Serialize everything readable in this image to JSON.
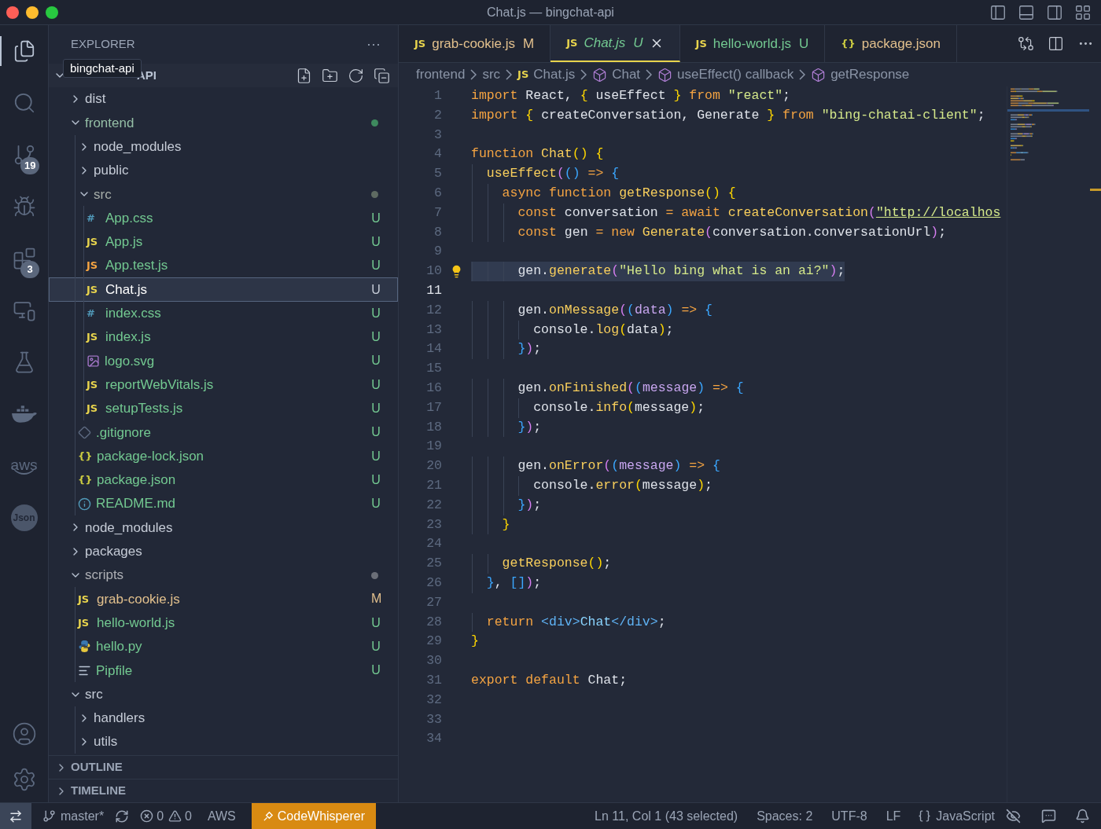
{
  "window": {
    "title": "Chat.js — bingchat-api"
  },
  "activity_bar": {
    "items": [
      {
        "kind": "files",
        "selected": true
      },
      {
        "kind": "search",
        "selected": false
      },
      {
        "kind": "source-control",
        "selected": false,
        "badge": "19"
      },
      {
        "kind": "run",
        "selected": false
      },
      {
        "kind": "extensions",
        "selected": false,
        "badge": "3"
      },
      {
        "kind": "remote",
        "selected": false
      },
      {
        "kind": "testing",
        "selected": false
      },
      {
        "kind": "docker",
        "selected": false
      },
      {
        "kind": "aws",
        "selected": false,
        "label": "aws"
      },
      {
        "kind": "json",
        "selected": false,
        "label": "Json"
      }
    ],
    "bottom": [
      {
        "kind": "account"
      },
      {
        "kind": "settings"
      }
    ]
  },
  "sidebar": {
    "title": "EXPLORER",
    "more": "···",
    "root": {
      "tooltip": "bingchat-api",
      "label_visible": "API",
      "expanded": true
    },
    "tree": [
      {
        "name": "dist",
        "kind": "folder",
        "expanded": false
      },
      {
        "name": "frontend",
        "kind": "folder",
        "expanded": true,
        "color": "#3e8a5e",
        "children": [
          {
            "name": "node_modules",
            "kind": "folder",
            "expanded": false
          },
          {
            "name": "public",
            "kind": "folder",
            "expanded": false
          },
          {
            "name": "src",
            "kind": "folder",
            "expanded": true,
            "color": "#5f6b62",
            "children": [
              {
                "name": "App.css",
                "kind": "css",
                "glyph": "#",
                "status": "U",
                "selected": false
              },
              {
                "name": "App.js",
                "kind": "js",
                "glyph": "JS",
                "status": "U",
                "selected": false
              },
              {
                "name": "App.test.js",
                "kind": "test",
                "glyph": "JS",
                "status": "U",
                "selected": false
              },
              {
                "name": "Chat.js",
                "kind": "js",
                "glyph": "JS",
                "status": "U",
                "selected": true
              },
              {
                "name": "index.css",
                "kind": "css",
                "glyph": "#",
                "status": "U",
                "selected": false
              },
              {
                "name": "index.js",
                "kind": "js",
                "glyph": "JS",
                "status": "U",
                "selected": false
              },
              {
                "name": "logo.svg",
                "kind": "image",
                "status": "U",
                "selected": false
              },
              {
                "name": "reportWebVitals.js",
                "kind": "js",
                "glyph": "JS",
                "status": "U",
                "selected": false
              },
              {
                "name": "setupTests.js",
                "kind": "js",
                "glyph": "JS",
                "status": "U",
                "selected": false
              }
            ]
          },
          {
            "name": ".gitignore",
            "kind": "git",
            "status": "U",
            "selected": false
          },
          {
            "name": "package-lock.json",
            "kind": "json",
            "glyph": "{}",
            "status": "U",
            "selected": false
          },
          {
            "name": "package.json",
            "kind": "json",
            "glyph": "{}",
            "status": "U",
            "selected": false
          },
          {
            "name": "README.md",
            "kind": "info",
            "status": "U",
            "selected": false
          }
        ]
      },
      {
        "name": "node_modules",
        "kind": "folder",
        "expanded": false
      },
      {
        "name": "packages",
        "kind": "folder",
        "expanded": false
      },
      {
        "name": "scripts",
        "kind": "folder",
        "expanded": true,
        "color": "#6b6f78",
        "children": [
          {
            "name": "grab-cookie.js",
            "kind": "js",
            "glyph": "JS",
            "status": "M",
            "selected": false
          },
          {
            "name": "hello-world.js",
            "kind": "js",
            "glyph": "JS",
            "status": "U",
            "selected": false
          },
          {
            "name": "hello.py",
            "kind": "python",
            "status": "U",
            "selected": false
          },
          {
            "name": "Pipfile",
            "kind": "lines",
            "status": "U",
            "selected": false
          }
        ]
      },
      {
        "name": "src",
        "kind": "folder",
        "expanded": true,
        "children": [
          {
            "name": "handlers",
            "kind": "folder",
            "expanded": false
          },
          {
            "name": "utils",
            "kind": "folder",
            "expanded": false
          }
        ]
      }
    ],
    "panels": [
      {
        "label": "OUTLINE",
        "expanded": false
      },
      {
        "label": "TIMELINE",
        "expanded": false
      }
    ]
  },
  "tabs": [
    {
      "glyph": "JS",
      "kind": "js",
      "label": "grab-cookie.js",
      "status": "M",
      "selected": false,
      "preview": false
    },
    {
      "glyph": "JS",
      "kind": "js",
      "label": "Chat.js",
      "status": "U",
      "selected": true,
      "preview": true
    },
    {
      "glyph": "JS",
      "kind": "js",
      "label": "hello-world.js",
      "status": "U",
      "selected": false,
      "preview": false
    },
    {
      "glyph": "{}",
      "kind": "json",
      "label": "package.json",
      "selected": false,
      "preview": false
    }
  ],
  "breadcrumbs": [
    {
      "kind": "folder",
      "label": "frontend"
    },
    {
      "kind": "folder",
      "label": "src"
    },
    {
      "kind": "file",
      "glyph": "JS",
      "label": "Chat.js"
    },
    {
      "kind": "symbol",
      "label": "Chat"
    },
    {
      "kind": "symbol",
      "label": "useEffect() callback"
    },
    {
      "kind": "symbol",
      "label": "getResponse"
    }
  ],
  "editor": {
    "lines": [
      {
        "n": "1",
        "current": false,
        "selected": false,
        "tokens": [
          {
            "kind": "keyword",
            "text": "import"
          },
          {
            "kind": "plain",
            "text": " React, "
          },
          {
            "kind": "brace",
            "text": "{"
          },
          {
            "kind": "plain",
            "text": " useEffect "
          },
          {
            "kind": "brace",
            "text": "}"
          },
          {
            "kind": "keyword",
            "text": " from "
          },
          {
            "kind": "string",
            "text": "\"react\""
          },
          {
            "kind": "plain",
            "text": ";"
          }
        ]
      },
      {
        "n": "2",
        "current": false,
        "selected": false,
        "tokens": [
          {
            "kind": "keyword",
            "text": "import"
          },
          {
            "kind": "brace",
            "text": " {"
          },
          {
            "kind": "plain",
            "text": " createConversation, Generate "
          },
          {
            "kind": "brace",
            "text": "}"
          },
          {
            "kind": "keyword",
            "text": " from "
          },
          {
            "kind": "string",
            "text": "\"bing-chatai-client\""
          },
          {
            "kind": "plain",
            "text": ";"
          }
        ]
      },
      {
        "n": "3",
        "current": false
      },
      {
        "n": "4",
        "current": false,
        "selected": false,
        "tokens": [
          {
            "kind": "keyword",
            "text": "function"
          },
          {
            "kind": "func",
            "text": " Chat"
          },
          {
            "kind": "brace",
            "text": "()"
          },
          {
            "kind": "brace",
            "text": " {"
          }
        ]
      },
      {
        "n": "5",
        "current": false,
        "selected": false,
        "tokens": [
          {
            "kind": "func",
            "text": "  useEffect"
          },
          {
            "kind": "paren",
            "text": "("
          },
          {
            "kind": "bracket",
            "text": "()"
          },
          {
            "kind": "keyword",
            "text": " => "
          },
          {
            "kind": "bracket",
            "text": "{"
          }
        ]
      },
      {
        "n": "6",
        "current": false,
        "selected": false,
        "tokens": [
          {
            "kind": "keyword",
            "text": "    async function"
          },
          {
            "kind": "func",
            "text": " getResponse"
          },
          {
            "kind": "brace",
            "text": "()"
          },
          {
            "kind": "brace",
            "text": " {"
          }
        ]
      },
      {
        "n": "7",
        "current": false,
        "selected": false,
        "tokens": [
          {
            "kind": "keyword",
            "text": "      const"
          },
          {
            "kind": "plain",
            "text": " conversation "
          },
          {
            "kind": "keyword",
            "text": "= await"
          },
          {
            "kind": "func",
            "text": " createConversation"
          },
          {
            "kind": "paren",
            "text": "("
          },
          {
            "kind": "link",
            "text": "\"http://localhos"
          }
        ]
      },
      {
        "n": "8",
        "current": false,
        "selected": false,
        "tokens": [
          {
            "kind": "keyword",
            "text": "      const"
          },
          {
            "kind": "plain",
            "text": " gen "
          },
          {
            "kind": "keyword",
            "text": "= new"
          },
          {
            "kind": "func",
            "text": " Generate"
          },
          {
            "kind": "paren",
            "text": "("
          },
          {
            "kind": "plain",
            "text": "conversation.conversationUrl"
          },
          {
            "kind": "paren",
            "text": ")"
          },
          {
            "kind": "plain",
            "text": ";"
          }
        ]
      },
      {
        "n": "9",
        "current": false
      },
      {
        "n": "10",
        "current": false,
        "selected": true,
        "kind": "lightbulb",
        "tokens": [
          {
            "kind": "plain",
            "text": "      gen."
          },
          {
            "kind": "func",
            "text": "generate"
          },
          {
            "kind": "paren",
            "text": "("
          },
          {
            "kind": "string",
            "text": "\"Hello bing what is an ai?\""
          },
          {
            "kind": "paren",
            "text": ")"
          },
          {
            "kind": "plain",
            "text": ";"
          }
        ]
      },
      {
        "n": "11",
        "current": true
      },
      {
        "n": "12",
        "current": false,
        "selected": false,
        "tokens": [
          {
            "kind": "plain",
            "text": "      gen."
          },
          {
            "kind": "func",
            "text": "onMessage"
          },
          {
            "kind": "paren",
            "text": "("
          },
          {
            "kind": "bracket",
            "text": "("
          },
          {
            "kind": "param",
            "text": "data"
          },
          {
            "kind": "bracket",
            "text": ")"
          },
          {
            "kind": "keyword",
            "text": " => "
          },
          {
            "kind": "bracket",
            "text": "{"
          }
        ]
      },
      {
        "n": "13",
        "current": false,
        "selected": false,
        "tokens": [
          {
            "kind": "plain",
            "text": "        console."
          },
          {
            "kind": "func",
            "text": "log"
          },
          {
            "kind": "brace",
            "text": "("
          },
          {
            "kind": "plain",
            "text": "data"
          },
          {
            "kind": "brace",
            "text": ")"
          },
          {
            "kind": "plain",
            "text": ";"
          }
        ]
      },
      {
        "n": "14",
        "current": false,
        "selected": false,
        "tokens": [
          {
            "kind": "bracket",
            "text": "      }"
          },
          {
            "kind": "paren",
            "text": ")"
          },
          {
            "kind": "plain",
            "text": ";"
          }
        ]
      },
      {
        "n": "15",
        "current": false
      },
      {
        "n": "16",
        "current": false,
        "selected": false,
        "tokens": [
          {
            "kind": "plain",
            "text": "      gen."
          },
          {
            "kind": "func",
            "text": "onFinished"
          },
          {
            "kind": "paren",
            "text": "("
          },
          {
            "kind": "bracket",
            "text": "("
          },
          {
            "kind": "param",
            "text": "message"
          },
          {
            "kind": "bracket",
            "text": ")"
          },
          {
            "kind": "keyword",
            "text": " => "
          },
          {
            "kind": "bracket",
            "text": "{"
          }
        ]
      },
      {
        "n": "17",
        "current": false,
        "selected": false,
        "tokens": [
          {
            "kind": "plain",
            "text": "        console."
          },
          {
            "kind": "func",
            "text": "info"
          },
          {
            "kind": "brace",
            "text": "("
          },
          {
            "kind": "plain",
            "text": "message"
          },
          {
            "kind": "brace",
            "text": ")"
          },
          {
            "kind": "plain",
            "text": ";"
          }
        ]
      },
      {
        "n": "18",
        "current": false,
        "selected": false,
        "tokens": [
          {
            "kind": "bracket",
            "text": "      }"
          },
          {
            "kind": "paren",
            "text": ")"
          },
          {
            "kind": "plain",
            "text": ";"
          }
        ]
      },
      {
        "n": "19",
        "current": false
      },
      {
        "n": "20",
        "current": false,
        "selected": false,
        "tokens": [
          {
            "kind": "plain",
            "text": "      gen."
          },
          {
            "kind": "func",
            "text": "onError"
          },
          {
            "kind": "paren",
            "text": "("
          },
          {
            "kind": "bracket",
            "text": "("
          },
          {
            "kind": "param",
            "text": "message"
          },
          {
            "kind": "bracket",
            "text": ")"
          },
          {
            "kind": "keyword",
            "text": " => "
          },
          {
            "kind": "bracket",
            "text": "{"
          }
        ]
      },
      {
        "n": "21",
        "current": false,
        "selected": false,
        "tokens": [
          {
            "kind": "plain",
            "text": "        console."
          },
          {
            "kind": "func",
            "text": "error"
          },
          {
            "kind": "brace",
            "text": "("
          },
          {
            "kind": "plain",
            "text": "message"
          },
          {
            "kind": "brace",
            "text": ")"
          },
          {
            "kind": "plain",
            "text": ";"
          }
        ]
      },
      {
        "n": "22",
        "current": false,
        "selected": false,
        "tokens": [
          {
            "kind": "bracket",
            "text": "      }"
          },
          {
            "kind": "paren",
            "text": ")"
          },
          {
            "kind": "plain",
            "text": ";"
          }
        ]
      },
      {
        "n": "23",
        "current": false,
        "selected": false,
        "tokens": [
          {
            "kind": "brace",
            "text": "    }"
          }
        ]
      },
      {
        "n": "24",
        "current": false
      },
      {
        "n": "25",
        "current": false,
        "selected": false,
        "tokens": [
          {
            "kind": "func",
            "text": "    getResponse"
          },
          {
            "kind": "brace",
            "text": "()"
          },
          {
            "kind": "plain",
            "text": ";"
          }
        ]
      },
      {
        "n": "26",
        "current": false,
        "selected": false,
        "tokens": [
          {
            "kind": "bracket",
            "text": "  }"
          },
          {
            "kind": "plain",
            "text": ", "
          },
          {
            "kind": "bracket",
            "text": "[]"
          },
          {
            "kind": "paren",
            "text": ")"
          },
          {
            "kind": "plain",
            "text": ";"
          }
        ]
      },
      {
        "n": "27",
        "current": false
      },
      {
        "n": "28",
        "current": false,
        "selected": false,
        "tokens": [
          {
            "kind": "keyword",
            "text": "  return"
          },
          {
            "kind": "tag",
            "text": " <div>"
          },
          {
            "kind": "jsx",
            "text": "Chat"
          },
          {
            "kind": "tag",
            "text": "</div>"
          },
          {
            "kind": "plain",
            "text": ";"
          }
        ]
      },
      {
        "n": "29",
        "current": false,
        "selected": false,
        "tokens": [
          {
            "kind": "brace",
            "text": "}"
          }
        ]
      },
      {
        "n": "30",
        "current": false
      },
      {
        "n": "31",
        "current": false,
        "selected": false,
        "tokens": [
          {
            "kind": "keyword",
            "text": "export default"
          },
          {
            "kind": "plain",
            "text": " Chat;"
          }
        ]
      },
      {
        "n": "32",
        "current": false
      },
      {
        "n": "33",
        "current": false
      },
      {
        "n": "34",
        "current": false
      }
    ]
  },
  "status_bar": {
    "branch": "master*",
    "errors": "0",
    "warnings": "0",
    "aws": "AWS",
    "codewhisperer": "CodeWhisperer",
    "position": "Ln 11, Col 1 (43 selected)",
    "spaces": "Spaces: 2",
    "encoding": "UTF-8",
    "eol": "LF",
    "language": "JavaScript"
  }
}
